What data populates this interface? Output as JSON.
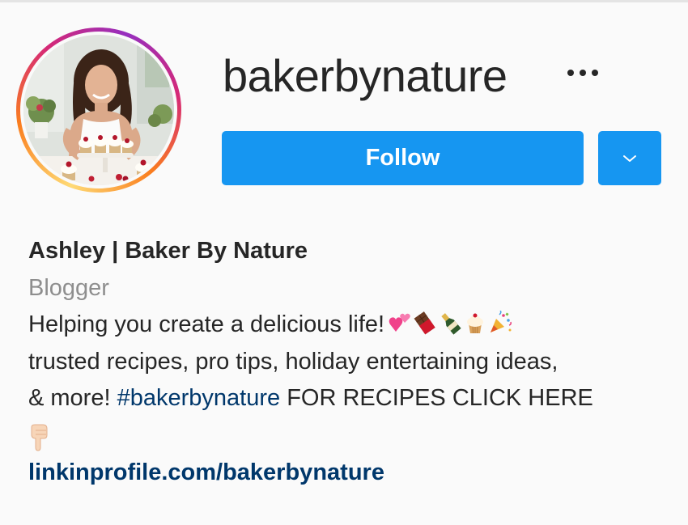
{
  "profile": {
    "username": "bakerbynature",
    "more_icon": "more-horizontal-icon",
    "follow_label": "Follow",
    "dropdown_icon": "chevron-down-icon",
    "avatar_icon": "profile-photo",
    "full_name": "Ashley | Baker By Nature",
    "category": "Blogger",
    "bio_line1": "Helping you create a delicious life!",
    "bio_line1_emojis": [
      "two-hearts-emoji",
      "chocolate-bar-emoji",
      "champagne-emoji",
      "cupcake-emoji",
      "party-popper-emoji"
    ],
    "bio_line2": "trusted recipes, pro tips, holiday entertaining ideas,",
    "bio_line3_prefix": "& more!",
    "hashtag": "#bakerbynature",
    "bio_line3_suffix": "FOR RECIPES CLICK HERE",
    "pointing_emoji": "backhand-index-pointing-down-emoji",
    "link": "linkinprofile.com/bakerbynature"
  },
  "colors": {
    "follow_bg": "#1696f1",
    "link": "#00376b",
    "category": "#8e8e8e",
    "text": "#262626"
  }
}
